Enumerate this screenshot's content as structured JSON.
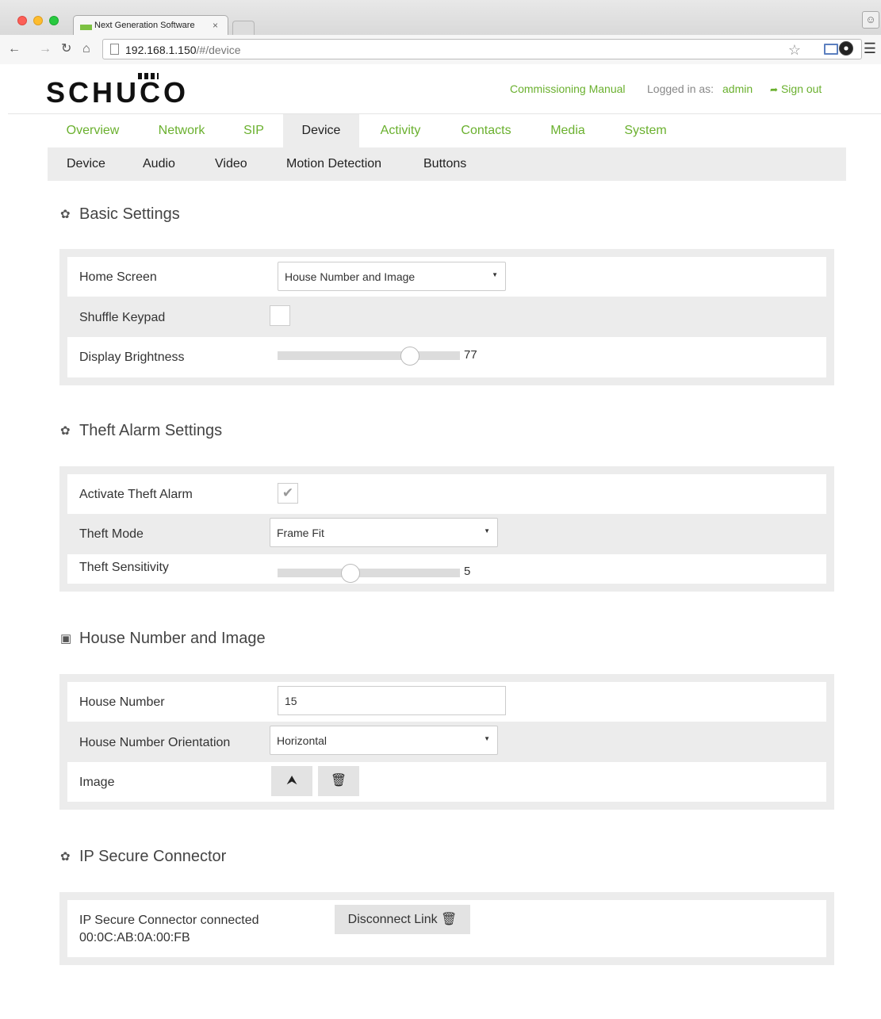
{
  "browser": {
    "tab_title": "Next Generation Software",
    "tab_close": "×",
    "url_host": "192.168.1.150",
    "url_path": "/#/device"
  },
  "header": {
    "logo": "SCHUCO",
    "manual_link": "Commissioning Manual",
    "logged_in_label": "Logged in as:",
    "user": "admin",
    "sign_out": "Sign out"
  },
  "main_tabs": [
    "Overview",
    "Network",
    "SIP",
    "Device",
    "Activity",
    "Contacts",
    "Media",
    "System"
  ],
  "sub_tabs": [
    "Device",
    "Audio",
    "Video",
    "Motion Detection",
    "Buttons"
  ],
  "basic": {
    "title": "Basic Settings",
    "home_screen_label": "Home Screen",
    "home_screen_value": "House Number and Image",
    "shuffle_label": "Shuffle Keypad",
    "shuffle_checked": false,
    "brightness_label": "Display Brightness",
    "brightness_value": "77"
  },
  "theft": {
    "title": "Theft Alarm Settings",
    "activate_label": "Activate Theft Alarm",
    "activate_checked": true,
    "mode_label": "Theft Mode",
    "mode_value": "Frame Fit",
    "sensitivity_label": "Theft Sensitivity",
    "sensitivity_value": "5"
  },
  "house": {
    "title": "House Number and Image",
    "number_label": "House Number",
    "number_value": "15",
    "orientation_label": "House Number Orientation",
    "orientation_value": "Horizontal",
    "image_label": "Image"
  },
  "ipsc": {
    "title": "IP Secure Connector",
    "status": "IP Secure Connector connected",
    "mac": "00:0C:AB:0A:00:FB",
    "disconnect": "Disconnect Link"
  },
  "icons": {
    "gear": "gear-icon",
    "image": "image-icon",
    "upload": "upload-icon",
    "trash": "trash-icon",
    "sign_out": "sign-out-icon"
  },
  "colors": {
    "accent": "#6ab02e",
    "panel": "#ececec"
  }
}
